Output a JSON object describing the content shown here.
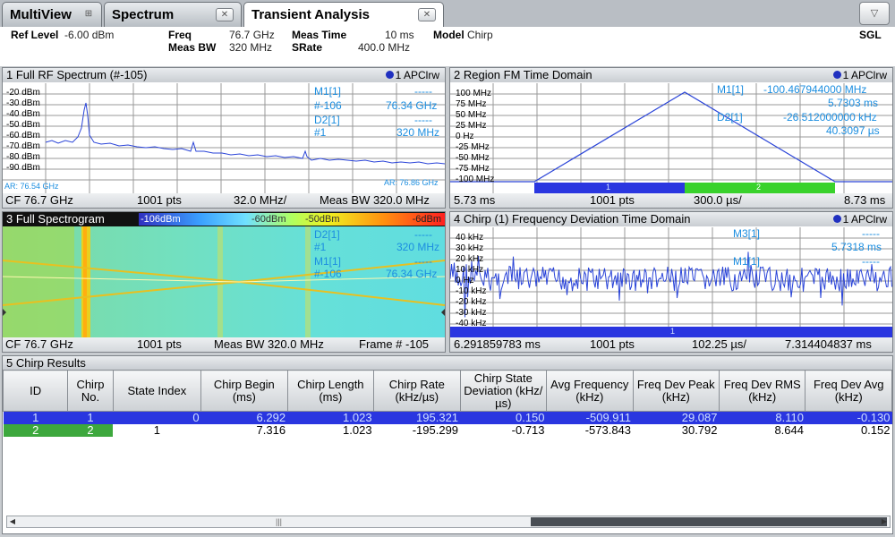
{
  "tabs": [
    {
      "label": "MultiView",
      "icon": "grid-icon"
    },
    {
      "label": "Spectrum",
      "icon": "close-icon"
    },
    {
      "label": "Transient Analysis",
      "icon": "close-icon"
    }
  ],
  "dropdown_icon": "▽",
  "info": {
    "ref_level_label": "Ref Level",
    "ref_level_value": "-6.00 dBm",
    "freq_label": "Freq",
    "freq_value": "76.7 GHz",
    "meas_bw_label": "Meas BW",
    "meas_bw_value": "320 MHz",
    "meas_time_label": "Meas Time",
    "meas_time_value": "10 ms",
    "srate_label": "SRate",
    "srate_value": "400.0 MHz",
    "model_label": "Model",
    "model_value": "Chirp",
    "sgl": "SGL"
  },
  "panel1": {
    "title": "1 Full RF Spectrum (#-105)",
    "trace": "1 APClrw",
    "yticks": [
      "-20 dBm",
      "-30 dBm",
      "-40 dBm",
      "-50 dBm",
      "-60 dBm",
      "-70 dBm",
      "-80 dBm",
      "-90 dBm"
    ],
    "markers": {
      "m1_label": "M1[1]",
      "m1_val": "-----",
      "m1_sub": "#-106",
      "m1_sub_val": "76.34 GHz",
      "d2_label": "D2[1]",
      "d2_val": "-----",
      "d2_sub": "#1",
      "d2_sub_val": "320 MHz"
    },
    "ar_left": "AR: 76.54 GHz",
    "ar_right": "AR: 76.86 GHz",
    "footer": {
      "left": "CF 76.7 GHz",
      "mid": "1001 pts",
      "div": "32.0 MHz/",
      "right": "Meas BW 320.0 MHz"
    }
  },
  "panel2": {
    "title": "2 Region FM Time Domain",
    "trace": "1 APClrw",
    "yticks": [
      "100 MHz",
      "75 MHz",
      "50 MHz",
      "25 MHz",
      "0 Hz",
      "-25 MHz",
      "-50 MHz",
      "-75 MHz",
      "-100 MHz"
    ],
    "markers": {
      "m1_label": "M1[1]",
      "m1_val": "-100.467944000 MHz",
      "m1_sub_val": "5.7303 ms",
      "d2_label": "D2[1]",
      "d2_val": "-26.512000000 kHz",
      "d2_sub_val": "40.3097 µs"
    },
    "region1": "1",
    "region2": "2",
    "footer": {
      "left": "5.73 ms",
      "mid": "1001 pts",
      "div": "300.0 µs/",
      "right": "8.73 ms"
    }
  },
  "panel3": {
    "title": "3 Full Spectrogram",
    "scale_labels": [
      "-106dBm",
      "-60dBm",
      "-50dBm",
      "-6dBm"
    ],
    "markers": {
      "d2_label": "D2[1]",
      "d2_val": "-----",
      "d2_sub": "#1",
      "d2_sub_val": "320 MHz",
      "m1_label": "M1[1]",
      "m1_val": "-----",
      "m1_sub": "#-106",
      "m1_sub_val": "76.34 GHz"
    },
    "footer": {
      "left": "CF 76.7 GHz",
      "mid": "1001 pts",
      "div": "Meas BW 320.0 MHz",
      "right": "Frame # -105"
    }
  },
  "panel4": {
    "title": "4 Chirp (1) Frequency Deviation Time Domain",
    "trace": "1 APClrw",
    "yticks": [
      "40 kHz",
      "30 kHz",
      "20 kHz",
      "10 kHz",
      "0 Hz",
      "-10 kHz",
      "-20 kHz",
      "-30 kHz",
      "-40 kHz"
    ],
    "markers": {
      "m3_label": "M3[1]",
      "m3_val": "-----",
      "m3_sub_val": "5.7318 ms",
      "m1_label": "M1[1]",
      "m1_val": "-----"
    },
    "region1": "1",
    "footer": {
      "left": "6.291859783 ms",
      "mid": "1001 pts",
      "div": "102.25 µs/",
      "right": "7.314404837 ms"
    }
  },
  "results": {
    "title": "5 Chirp Results",
    "headers": [
      "ID",
      "Chirp No.",
      "State Index",
      "Chirp Begin (ms)",
      "Chirp Length (ms)",
      "Chirp Rate (kHz/µs)",
      "Chirp State Deviation (kHz/µs)",
      "Avg Frequency (kHz)",
      "Freq Dev Peak (kHz)",
      "Freq Dev RMS (kHz)",
      "Freq Dev Avg (kHz)"
    ],
    "rows": [
      [
        "1",
        "1",
        "0",
        "6.292",
        "1.023",
        "195.321",
        "0.150",
        "-509.911",
        "29.087",
        "8.110",
        "-0.130"
      ],
      [
        "2",
        "2",
        "1",
        "7.316",
        "1.023",
        "-195.299",
        "-0.713",
        "-573.843",
        "30.792",
        "8.644",
        "0.152"
      ]
    ]
  }
}
